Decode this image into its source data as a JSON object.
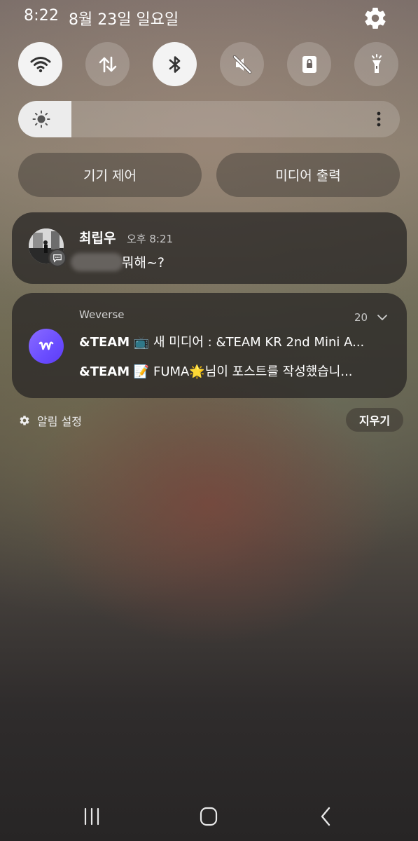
{
  "status_bar": {
    "time": "8:22",
    "date": "8월 23일 일요일",
    "settings_icon": "gear-icon"
  },
  "quick_settings": [
    {
      "name": "wifi",
      "icon": "wifi-icon",
      "active": true
    },
    {
      "name": "mobile-data",
      "icon": "data-arrows-icon",
      "active": false
    },
    {
      "name": "bluetooth",
      "icon": "bluetooth-icon",
      "active": true
    },
    {
      "name": "sound",
      "icon": "mute-icon",
      "active": false
    },
    {
      "name": "screen-lock",
      "icon": "lock-icon",
      "active": false
    },
    {
      "name": "flashlight",
      "icon": "flashlight-icon",
      "active": false
    }
  ],
  "brightness": {
    "level": 0.14
  },
  "buttons": {
    "device_control": "기기 제어",
    "media_output": "미디어 출력"
  },
  "notifications": [
    {
      "sender": "최립우",
      "time": "오후 8:21",
      "message": "뭐해~?"
    },
    {
      "app": "Weverse",
      "count": "20",
      "lines": [
        {
          "source": "&TEAM",
          "text": " 📺 새 미디어 : &TEAM KR 2nd Mini A..."
        },
        {
          "source": "&TEAM",
          "text": " 📝 FUMA🌟님이 포스트를 작성했습니..."
        }
      ]
    }
  ],
  "footer": {
    "notification_settings": "알림 설정",
    "clear": "지우기"
  },
  "colors": {
    "weverse_brand": "#6a4dff",
    "toggle_on": "#f3f3f3"
  }
}
